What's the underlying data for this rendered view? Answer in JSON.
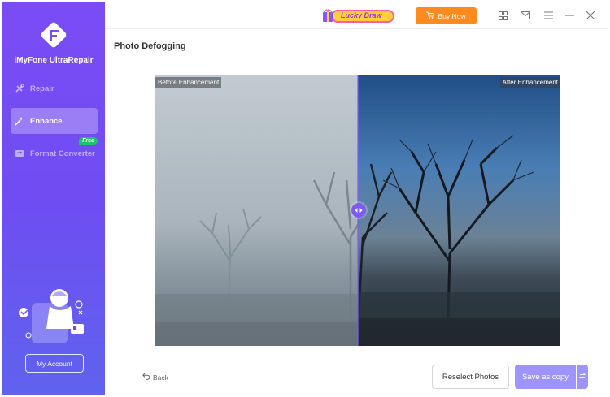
{
  "app": {
    "name": "iMyFone UltraRepair"
  },
  "sidebar": {
    "items": [
      {
        "label": "Repair",
        "icon": "tools-icon"
      },
      {
        "label": "Enhance",
        "icon": "magic-wand-icon",
        "active": true
      },
      {
        "label": "Format Converter",
        "icon": "convert-icon",
        "badge": "Free"
      }
    ],
    "account_label": "My Account"
  },
  "topbar": {
    "promo_label": "Lucky Draw",
    "buy_label": "Buy Now",
    "icons": [
      "grid-icon",
      "mail-icon",
      "menu-icon",
      "minimize-icon",
      "close-icon"
    ]
  },
  "main": {
    "title": "Photo Defogging",
    "before_label": "Before Enhancement",
    "after_label": "After Enhancement"
  },
  "footer": {
    "back_label": "Back",
    "reselect_label": "Reselect Photos",
    "save_label": "Save as copy"
  },
  "colors": {
    "sidebar_top": "#7b4cf5",
    "sidebar_bottom": "#5f63ee",
    "buy_button": "#ff8a1e",
    "save_button": "#9e94ff",
    "free_badge": "#20c36b"
  }
}
